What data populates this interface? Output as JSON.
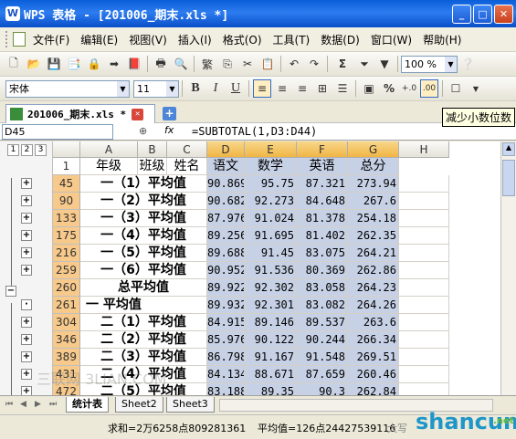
{
  "window": {
    "title": "WPS 表格 - [201006_期末.xls *]",
    "app_icon": "W"
  },
  "menu": [
    "文件(F)",
    "编辑(E)",
    "视图(V)",
    "插入(I)",
    "格式(O)",
    "工具(T)",
    "数据(D)",
    "窗口(W)",
    "帮助(H)"
  ],
  "toolbar": {
    "zoom": "100 %",
    "font_name": "宋体",
    "font_size": "11",
    "bold": "B",
    "italic": "I",
    "underline": "U",
    "sigma": "Σ",
    "percent": "%"
  },
  "tabs": {
    "doc_tab": "201006_期末.xls *"
  },
  "tooltip": "减少小数位数",
  "formula_bar": {
    "name_box": "D45",
    "fx": "fx",
    "formula": "=SUBTOTAL(1,D3:D44)"
  },
  "outline_levels": [
    "1",
    "2",
    "3"
  ],
  "columns": [
    "A",
    "B",
    "C",
    "D",
    "E",
    "F",
    "G",
    "H"
  ],
  "header_row": {
    "row": "1",
    "cells": [
      "年级",
      "班级",
      "姓名",
      "语文",
      "数学",
      "英语",
      "总分"
    ]
  },
  "rows": [
    {
      "row": "45",
      "label": "一（1）平均值",
      "d": "90.869",
      "e": "95.75",
      "f": "87.321",
      "g": "273.94"
    },
    {
      "row": "90",
      "label": "一（2）平均值",
      "d": "90.682",
      "e": "92.273",
      "f": "84.648",
      "g": "267.6"
    },
    {
      "row": "133",
      "label": "一（3）平均值",
      "d": "87.976",
      "e": "91.024",
      "f": "81.378",
      "g": "254.18"
    },
    {
      "row": "175",
      "label": "一（4）平均值",
      "d": "89.256",
      "e": "91.695",
      "f": "81.402",
      "g": "262.35"
    },
    {
      "row": "216",
      "label": "一（5）平均值",
      "d": "89.688",
      "e": "91.45",
      "f": "83.075",
      "g": "264.21"
    },
    {
      "row": "259",
      "label": "一（6）平均值",
      "d": "90.952",
      "e": "91.536",
      "f": "80.369",
      "g": "262.86"
    },
    {
      "row": "260",
      "label": "总平均值",
      "d": "89.922",
      "e": "92.302",
      "f": "83.058",
      "g": "264.23"
    },
    {
      "row": "261",
      "label": "一 平均值",
      "d": "89.932",
      "e": "92.301",
      "f": "83.082",
      "g": "264.26"
    },
    {
      "row": "304",
      "label": "二（1）平均值",
      "d": "84.915",
      "e": "89.146",
      "f": "89.537",
      "g": "263.6"
    },
    {
      "row": "346",
      "label": "二（2）平均值",
      "d": "85.976",
      "e": "90.122",
      "f": "90.244",
      "g": "266.34"
    },
    {
      "row": "389",
      "label": "二（3）平均值",
      "d": "86.798",
      "e": "91.167",
      "f": "91.548",
      "g": "269.51"
    },
    {
      "row": "431",
      "label": "二（4）平均值",
      "d": "84.134",
      "e": "88.671",
      "f": "87.659",
      "g": "260.46"
    },
    {
      "row": "472",
      "label": "二（5）平均值",
      "d": "83.188",
      "e": "89.35",
      "f": "90.3",
      "g": "262.84"
    }
  ],
  "sheets": [
    "统计表",
    "Sheet2",
    "Sheet3"
  ],
  "status": {
    "sum": "求和=2万6258点809281361",
    "avg": "平均值=126点24427539116",
    "caps": "大写"
  },
  "watermarks": {
    "left": "三联网 3LIAN.COM",
    "right": "shancun",
    "right_sub": ".net"
  },
  "colors": {
    "selected_range": "#c7d1e6",
    "row_header_selected": "#f7c98a",
    "accent": "#316ac5"
  }
}
